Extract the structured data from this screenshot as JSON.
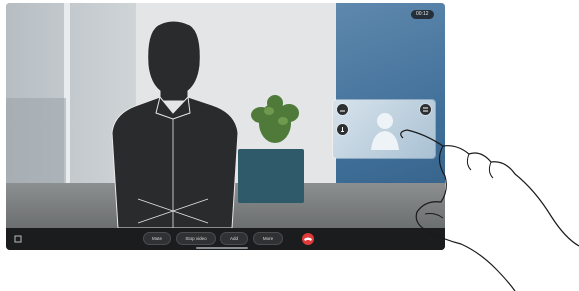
{
  "call": {
    "timer": "00:12",
    "controls": [
      {
        "id": "mute",
        "label": "Mute"
      },
      {
        "id": "stop_video",
        "label": "Stop video"
      },
      {
        "id": "add",
        "label": "Add"
      },
      {
        "id": "more",
        "label": "More"
      }
    ],
    "end_call_color": "#e03a3a"
  },
  "self_view": {
    "buttons": [
      "minimize-icon",
      "swap-icon",
      "close-icon",
      "mute-self-icon"
    ]
  }
}
